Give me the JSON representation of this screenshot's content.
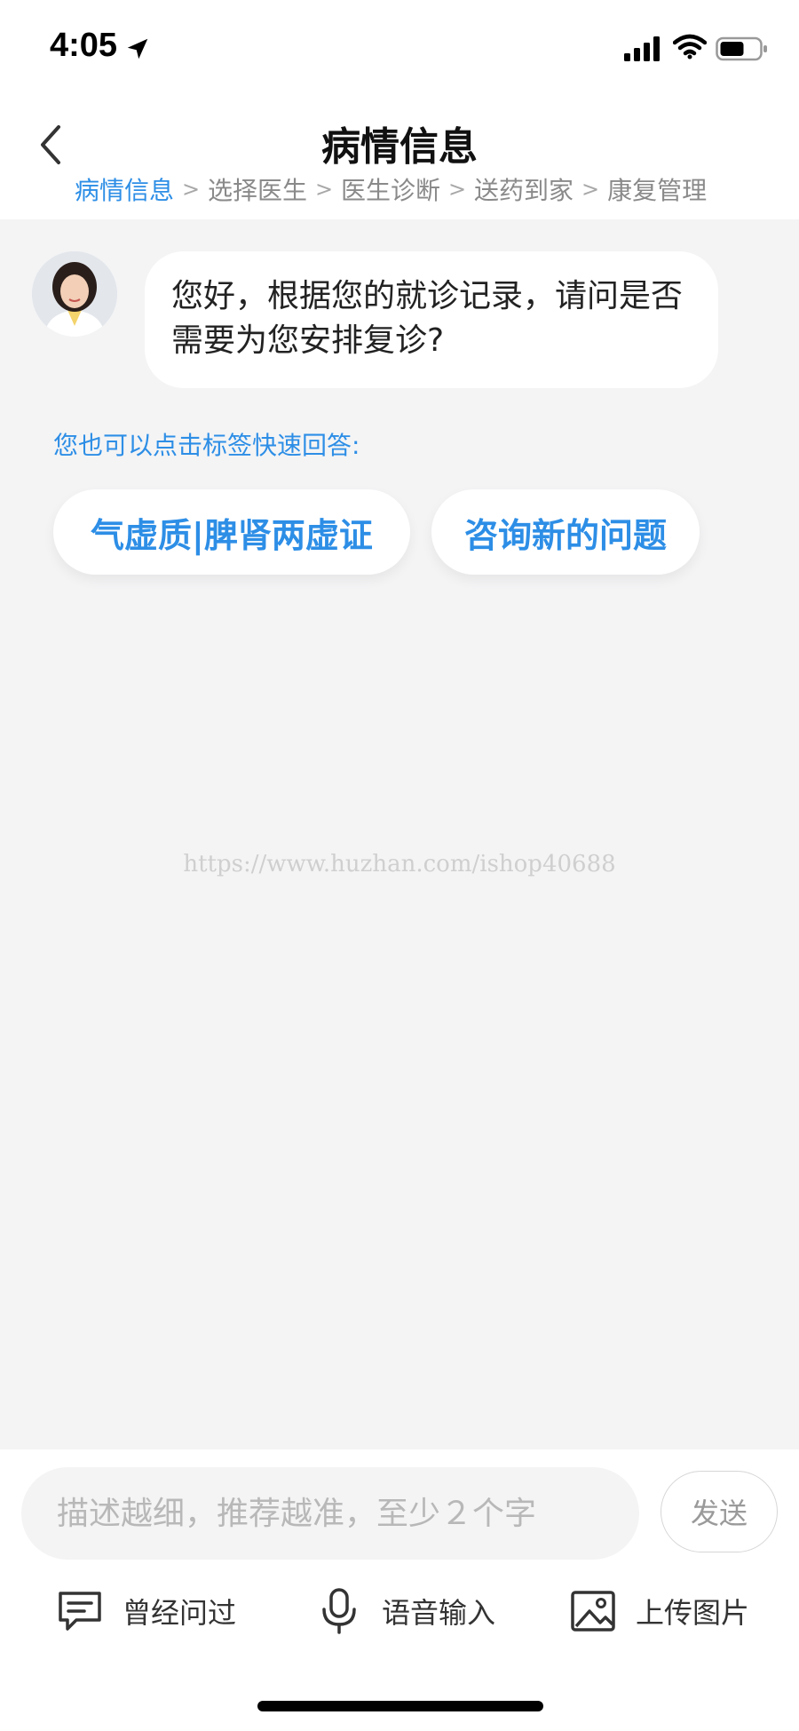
{
  "status_bar": {
    "time": "4:05",
    "icons": [
      "location-arrow-icon",
      "signal-icon",
      "wifi-icon",
      "battery-icon"
    ]
  },
  "header": {
    "title": "病情信息",
    "back_icon": "chevron-left-icon",
    "steps": [
      {
        "label": "病情信息",
        "active": true
      },
      {
        "label": "选择医生",
        "active": false
      },
      {
        "label": "医生诊断",
        "active": false
      },
      {
        "label": "送药到家",
        "active": false
      },
      {
        "label": "康复管理",
        "active": false
      }
    ],
    "step_separator": ">"
  },
  "chat": {
    "doctor_message": "您好，根据您的就诊记录，请问是否需要为您安排复诊?",
    "hint": "您也可以点击标签快速回答:",
    "quick_replies": [
      "气虚质|脾肾两虚证",
      "咨询新的问题"
    ]
  },
  "watermark": "https://www.huzhan.com/ishop40688",
  "composer": {
    "placeholder": "描述越细，推荐越准，至少２个字",
    "value": "",
    "send_label": "发送",
    "tools": [
      {
        "label": "曾经问过",
        "icon": "chat-history-icon"
      },
      {
        "label": "语音输入",
        "icon": "microphone-icon"
      },
      {
        "label": "上传图片",
        "icon": "image-upload-icon"
      }
    ]
  },
  "colors": {
    "accent": "#2d8ee6",
    "background": "#f4f4f5",
    "surface": "#ffffff",
    "muted_text": "#8a8a8a"
  }
}
